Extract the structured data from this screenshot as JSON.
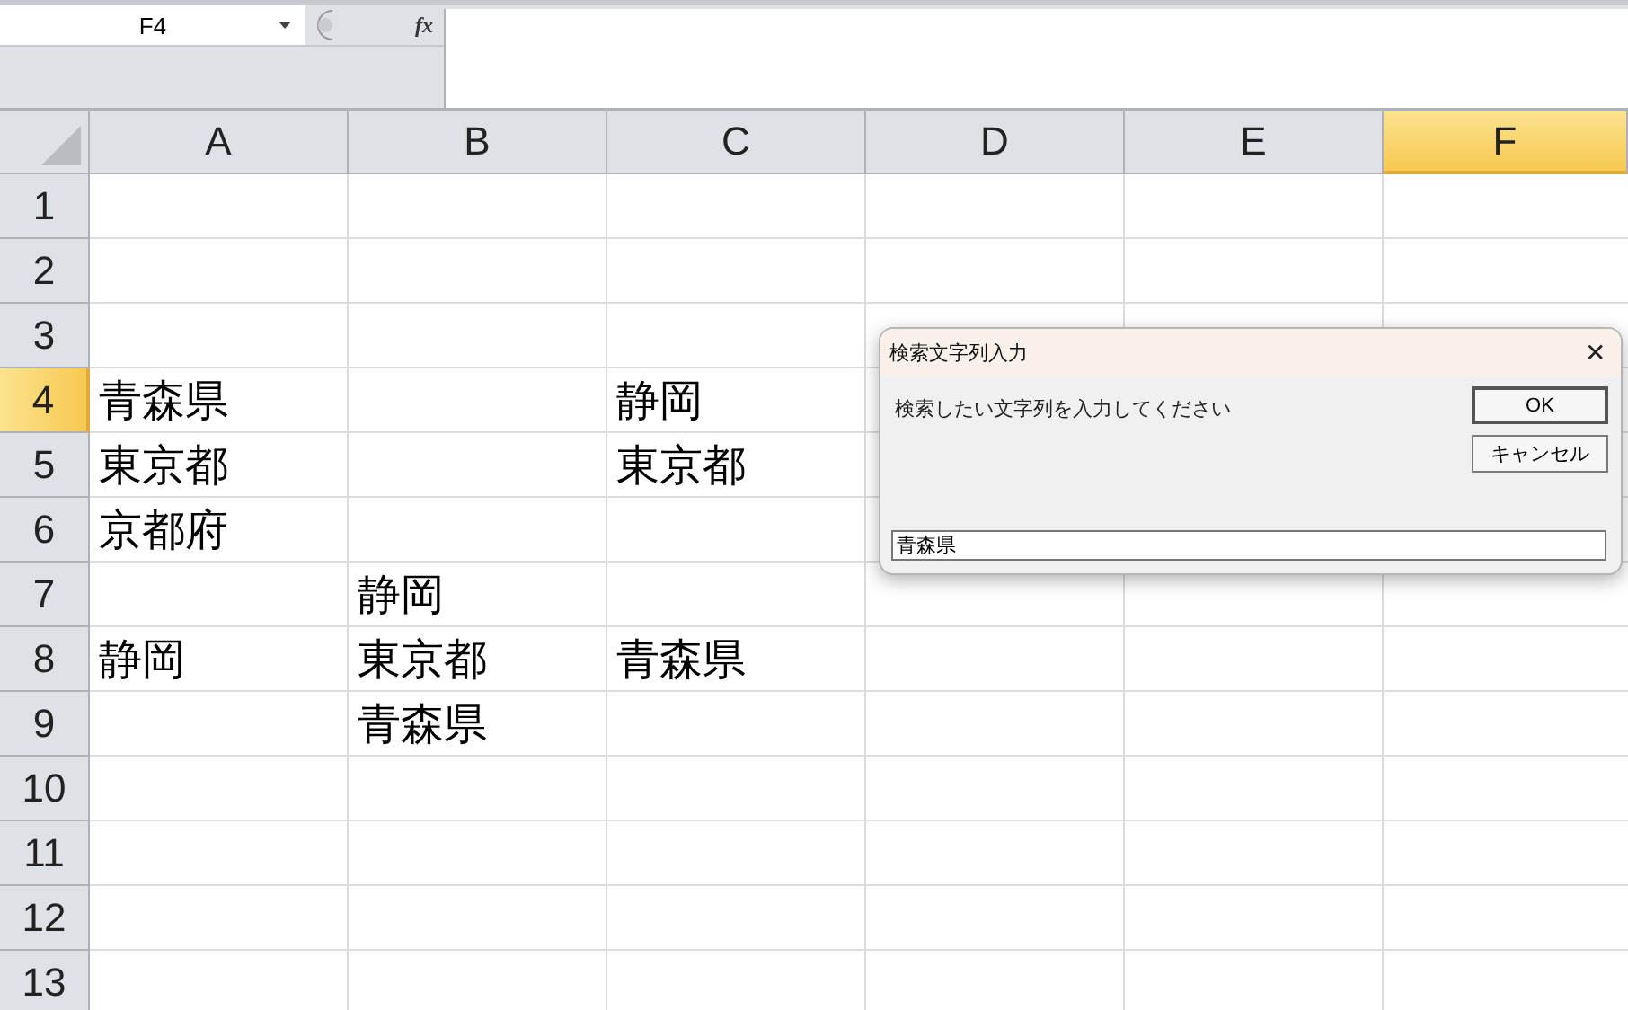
{
  "name_box": {
    "value": "F4"
  },
  "formula_bar": {
    "fx": "fx"
  },
  "columns": [
    {
      "label": "A",
      "selected": false
    },
    {
      "label": "B",
      "selected": false
    },
    {
      "label": "C",
      "selected": false
    },
    {
      "label": "D",
      "selected": false
    },
    {
      "label": "E",
      "selected": false
    },
    {
      "label": "F",
      "selected": true
    }
  ],
  "rows": [
    {
      "label": "1",
      "selected": false,
      "cells": [
        null,
        null,
        null,
        null,
        null,
        null
      ]
    },
    {
      "label": "2",
      "selected": false,
      "cells": [
        null,
        null,
        null,
        null,
        null,
        null
      ]
    },
    {
      "label": "3",
      "selected": false,
      "cells": [
        null,
        null,
        null,
        null,
        null,
        null
      ]
    },
    {
      "label": "4",
      "selected": true,
      "cells": [
        "青森県",
        null,
        "静岡",
        null,
        null,
        null
      ]
    },
    {
      "label": "5",
      "selected": false,
      "cells": [
        "東京都",
        null,
        "東京都",
        null,
        null,
        null
      ]
    },
    {
      "label": "6",
      "selected": false,
      "cells": [
        "京都府",
        null,
        null,
        null,
        null,
        null
      ]
    },
    {
      "label": "7",
      "selected": false,
      "cells": [
        null,
        "静岡",
        null,
        null,
        null,
        null
      ]
    },
    {
      "label": "8",
      "selected": false,
      "cells": [
        "静岡",
        "東京都",
        "青森県",
        null,
        null,
        null
      ]
    },
    {
      "label": "9",
      "selected": false,
      "cells": [
        null,
        "青森県",
        null,
        null,
        null,
        null
      ]
    },
    {
      "label": "10",
      "selected": false,
      "cells": [
        null,
        null,
        null,
        null,
        null,
        null
      ]
    },
    {
      "label": "11",
      "selected": false,
      "cells": [
        null,
        null,
        null,
        null,
        null,
        null
      ]
    },
    {
      "label": "12",
      "selected": false,
      "cells": [
        null,
        null,
        null,
        null,
        null,
        null
      ]
    },
    {
      "label": "13",
      "selected": false,
      "cells": [
        null,
        null,
        null,
        null,
        null,
        null
      ]
    }
  ],
  "dialog": {
    "title": "検索文字列入力",
    "close": "✕",
    "prompt": "検索したい文字列を入力してください",
    "buttons": [
      "OK",
      "キャンセル"
    ],
    "input_value": "青森県"
  }
}
